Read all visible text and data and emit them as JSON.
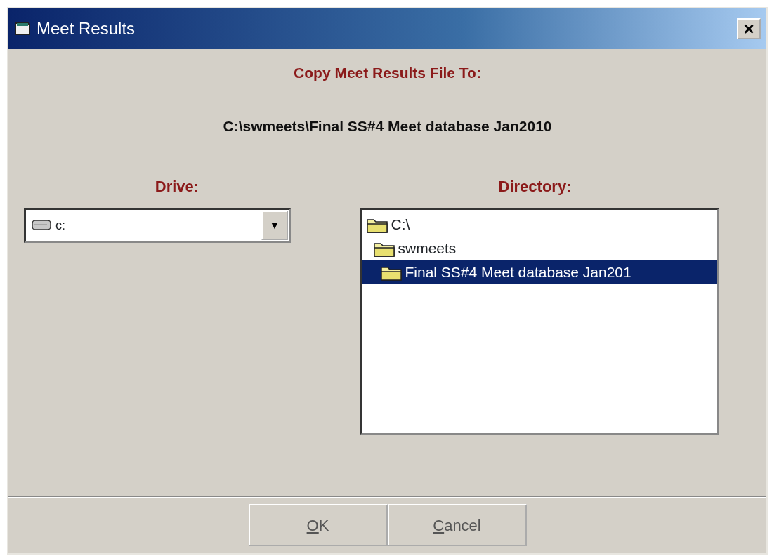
{
  "window": {
    "title": "Meet Results",
    "close": "×"
  },
  "heading": "Copy Meet Results File To:",
  "path": "C:\\swmeets\\Final SS#4 Meet database Jan2010",
  "drive": {
    "label": "Drive:",
    "value": "c:",
    "arrow": "▼"
  },
  "directory": {
    "label": "Directory:",
    "tree": [
      {
        "label": "C:\\",
        "selected": false,
        "children": [
          {
            "label": "swmeets",
            "selected": false,
            "children": [
              {
                "label": "Final SS#4 Meet database Jan201",
                "selected": true
              }
            ]
          }
        ]
      }
    ]
  },
  "buttons": [
    {
      "label": "OK"
    },
    {
      "label": "Cancel"
    }
  ]
}
